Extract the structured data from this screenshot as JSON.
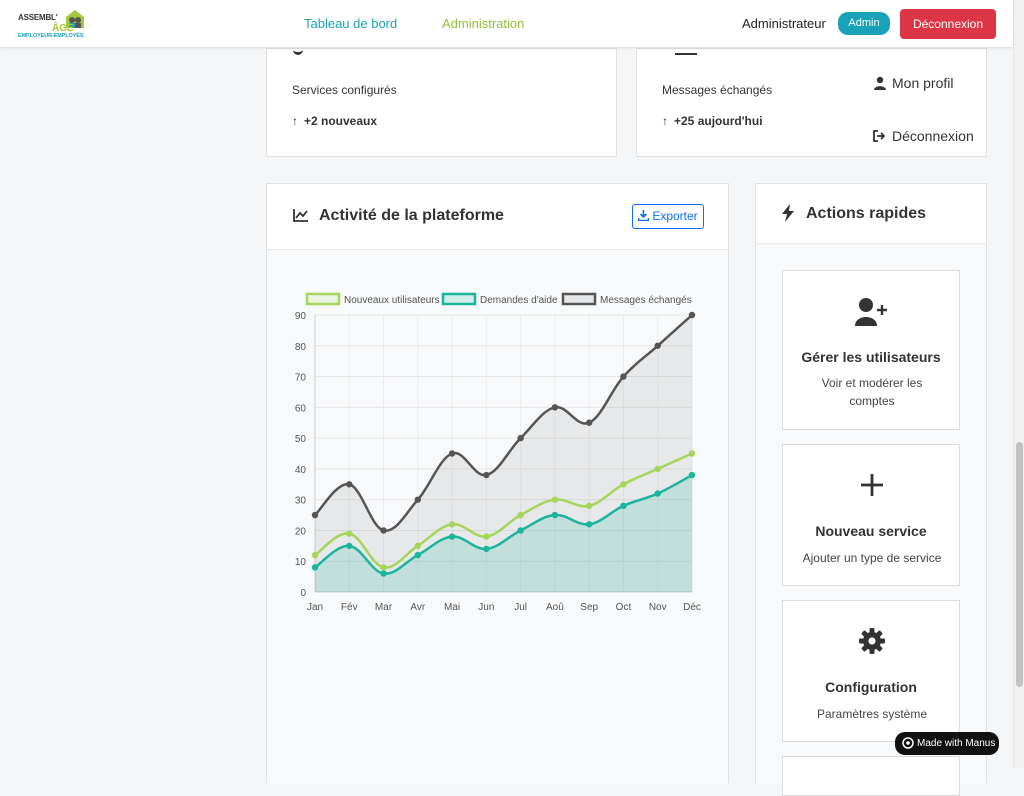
{
  "brand": {
    "line1": "ASSEMBL'",
    "line2": "ÂGE",
    "line3": "EMPLOYEUR-EMPLOYÉS"
  },
  "nav": {
    "dashboard": "Tableau de bord",
    "administration": "Administration",
    "user_name": "Administrateur",
    "role_badge": "Admin",
    "logout_button": "Déconnexion"
  },
  "stats": [
    {
      "label": "Services configurés",
      "delta": "+2 nouveaux"
    },
    {
      "label": "Messages échangés",
      "delta": "+25 aujourd'hui"
    }
  ],
  "user_menu": {
    "profile": "Mon profil",
    "logout": "Déconnexion"
  },
  "activity": {
    "title": "Activité de la plateforme",
    "export_label": "Exporter"
  },
  "quick_actions": {
    "title": "Actions rapides",
    "items": [
      {
        "title": "Gérer les utilisateurs",
        "description": "Voir et modérer les comptes",
        "icon": "user-plus-icon"
      },
      {
        "title": "Nouveau service",
        "description": "Ajouter un type de service",
        "icon": "plus-icon"
      },
      {
        "title": "Configuration",
        "description": "Paramètres système",
        "icon": "gear-icon"
      }
    ]
  },
  "badge": {
    "manus": "Made with Manus"
  },
  "colors": {
    "primary": "#17a2b8",
    "lime": "#a3d65a",
    "teal": "#1bb59c",
    "gray": "#555555",
    "danger": "#dc3545"
  },
  "chart_data": {
    "type": "line",
    "categories": [
      "Jan",
      "Fév",
      "Mar",
      "Avr",
      "Mai",
      "Jun",
      "Jul",
      "Aoû",
      "Sep",
      "Oct",
      "Nov",
      "Déc"
    ],
    "series": [
      {
        "name": "Nouveaux utilisateurs",
        "values": [
          12,
          19,
          8,
          15,
          22,
          18,
          25,
          30,
          28,
          35,
          40,
          45
        ],
        "color": "#a3d65a",
        "fill": false
      },
      {
        "name": "Demandes d'aide",
        "values": [
          8,
          15,
          6,
          12,
          18,
          14,
          20,
          25,
          22,
          28,
          32,
          38
        ],
        "color": "#1bb59c",
        "fill": true
      },
      {
        "name": "Messages échangés",
        "values": [
          25,
          35,
          20,
          30,
          45,
          38,
          50,
          60,
          55,
          70,
          80,
          90
        ],
        "color": "#555555",
        "fill": true
      }
    ],
    "y_ticks": [
      0,
      10,
      20,
      30,
      40,
      50,
      60,
      70,
      80,
      90
    ],
    "ylim": [
      0,
      90
    ],
    "grid": true,
    "legend": "top"
  }
}
